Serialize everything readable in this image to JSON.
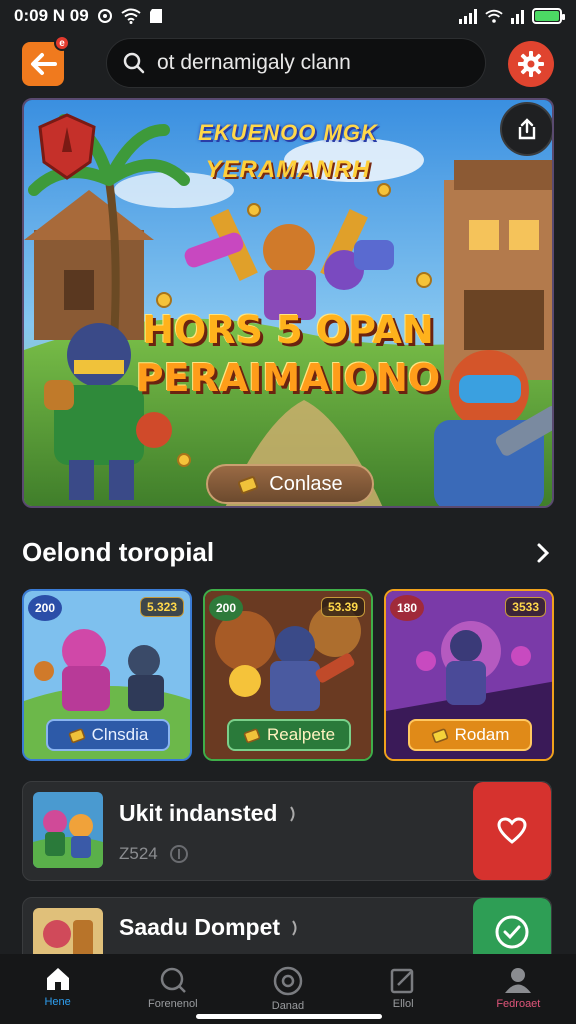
{
  "status_bar": {
    "time": "0:09 N 09"
  },
  "search": {
    "placeholder": "ot dernamigaly clann",
    "value": ""
  },
  "top_bar": {
    "notification_count": "e"
  },
  "hero": {
    "title_line1": "EKUENOO MGK",
    "title_line2": "YERAMANRH",
    "main_line1": "HORS 5 OPAN",
    "main_line2": "PERAIMAIONO",
    "cta_label": "Conlase"
  },
  "section": {
    "title": "Oelond toropial"
  },
  "cards": [
    {
      "badge_left": "200",
      "badge_right": "5.323",
      "button_label": "Clnsdia",
      "accent": "#3a7bd5"
    },
    {
      "badge_left": "200",
      "badge_right": "53.39",
      "button_label": "Realpete",
      "accent": "#3fae49"
    },
    {
      "badge_left": "180",
      "badge_right": "3533",
      "button_label": "Rodam",
      "accent": "#f0a21c"
    }
  ],
  "list": [
    {
      "title": "Ukit indansted",
      "subtitle": "Z524",
      "action_icon": "heart-icon",
      "action_color": "#d6322e"
    },
    {
      "title": "Saadu Dompet",
      "subtitle": "",
      "action_icon": "check-icon",
      "action_color": "#2e9e55"
    }
  ],
  "nav": [
    {
      "label": "Hene",
      "icon": "home-icon"
    },
    {
      "label": "Forenenol",
      "icon": "search-icon"
    },
    {
      "label": "Danad",
      "icon": "disc-icon"
    },
    {
      "label": "Ellol",
      "icon": "edit-icon"
    },
    {
      "label": "Fedroaet",
      "icon": "profile-icon"
    }
  ],
  "colors": {
    "accent_orange": "#f07a1e",
    "settings_red": "#e0442f",
    "nav_active": "#2e9ff0"
  }
}
